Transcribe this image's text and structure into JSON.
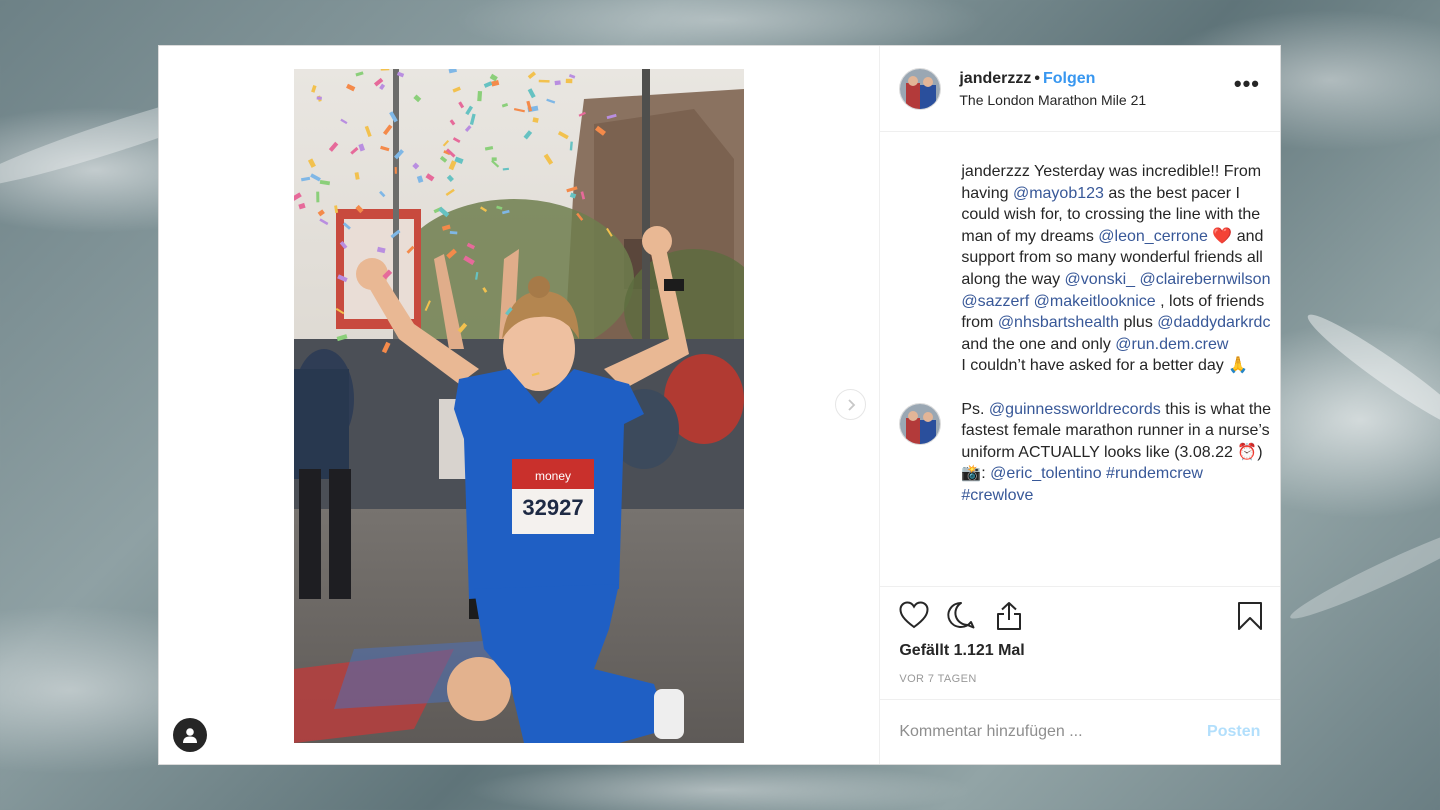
{
  "post": {
    "username": "janderzzz",
    "separator": "•",
    "follow_label": "Folgen",
    "location": "The London Marathon Mile 21",
    "more_label": "•••",
    "bib_number": "32927",
    "bib_sponsor": "money"
  },
  "caption": {
    "username": "janderzzz",
    "segments": [
      {
        "t": " Yesterday was incredible!! From having ",
        "m": false
      },
      {
        "t": "@mayob123",
        "m": true
      },
      {
        "t": " as the best pacer I could wish for, to crossing the line with the man of my dreams ",
        "m": false
      },
      {
        "t": "@leon_cerrone",
        "m": true
      },
      {
        "t": " ❤️ and support from so many wonderful friends all along the way ",
        "m": false
      },
      {
        "t": "@vonski_",
        "m": true
      },
      {
        "t": " ",
        "m": false
      },
      {
        "t": "@clairebernwilson",
        "m": true
      },
      {
        "t": " ",
        "m": false
      },
      {
        "t": "@sazzerf",
        "m": true
      },
      {
        "t": " ",
        "m": false
      },
      {
        "t": "@makeitlooknice",
        "m": true
      },
      {
        "t": " , lots of friends from ",
        "m": false
      },
      {
        "t": "@nhsbartshealth",
        "m": true
      },
      {
        "t": " plus ",
        "m": false
      },
      {
        "t": "@daddydarkrdc",
        "m": true
      },
      {
        "t": " and the one and only ",
        "m": false
      },
      {
        "t": "@run.dem.crew",
        "m": true
      }
    ],
    "line2": "I couldn’t have asked for a better day 🙏",
    "ps_segments": [
      {
        "t": "Ps. ",
        "m": false
      },
      {
        "t": "@guinnessworldrecords",
        "m": true
      },
      {
        "t": " this is what the fastest female marathon runner in a nurse’s uniform ACTUALLY looks like (3.08.22 ⏰) 📸: ",
        "m": false
      },
      {
        "t": "@eric_tolentino",
        "m": true
      },
      {
        "t": " ",
        "m": false
      },
      {
        "t": "#rundemcrew",
        "m": true
      },
      {
        "t": " ",
        "m": false
      },
      {
        "t": "#crewlove",
        "m": true
      }
    ]
  },
  "actions": {
    "like_icon": "heart-icon",
    "comment_icon": "comment-icon",
    "share_icon": "share-icon",
    "save_icon": "bookmark-icon",
    "likes_text": "Gefällt 1.121 Mal",
    "date_text": "VOR 7 TAGEN"
  },
  "comment": {
    "placeholder": "Kommentar hinzufügen ...",
    "post_label": "Posten"
  },
  "colors": {
    "link": "#3897f0",
    "mention": "#385898",
    "post_disabled": "#b2dffc",
    "scrubs": "#1f5fc4"
  }
}
